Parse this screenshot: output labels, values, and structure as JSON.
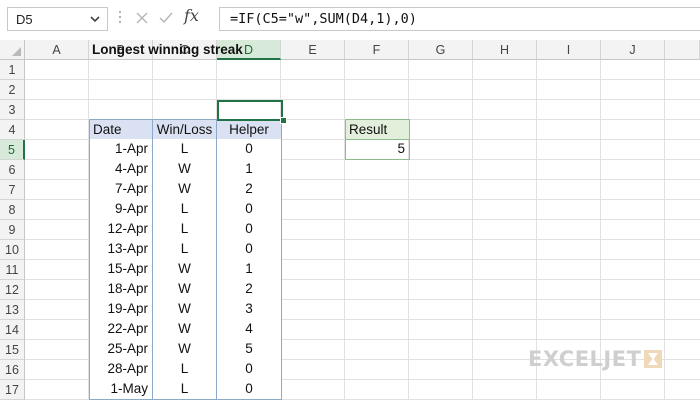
{
  "formula_bar": {
    "name_box": "D5",
    "fx_label": "fx",
    "formula": "=IF(C5=\"w\",SUM(D4,1),0)"
  },
  "column_headers": [
    "A",
    "B",
    "C",
    "D",
    "E",
    "F",
    "G",
    "H",
    "I",
    "J"
  ],
  "selected_column": "D",
  "row_numbers": [
    "1",
    "2",
    "3",
    "4",
    "5",
    "6",
    "7",
    "8",
    "9",
    "10",
    "11",
    "12",
    "13",
    "14",
    "15",
    "16",
    "17"
  ],
  "selected_row": "5",
  "sheet": {
    "title": "Longest winning streak",
    "table": {
      "headers": [
        "Date",
        "Win/Loss",
        "Helper"
      ],
      "rows": [
        [
          "1-Apr",
          "L",
          "0"
        ],
        [
          "4-Apr",
          "W",
          "1"
        ],
        [
          "7-Apr",
          "W",
          "2"
        ],
        [
          "9-Apr",
          "L",
          "0"
        ],
        [
          "12-Apr",
          "L",
          "0"
        ],
        [
          "13-Apr",
          "L",
          "0"
        ],
        [
          "15-Apr",
          "W",
          "1"
        ],
        [
          "18-Apr",
          "W",
          "2"
        ],
        [
          "19-Apr",
          "W",
          "3"
        ],
        [
          "22-Apr",
          "W",
          "4"
        ],
        [
          "25-Apr",
          "W",
          "5"
        ],
        [
          "28-Apr",
          "L",
          "0"
        ],
        [
          "1-May",
          "L",
          "0"
        ]
      ]
    },
    "result": {
      "label": "Result",
      "value": "5"
    }
  },
  "watermark": {
    "text": "EXCELJET"
  },
  "colors": {
    "table_header": "#d9e1f2",
    "table_border": "#8eaacb",
    "result_header": "#e2efda",
    "result_border": "#8dbb8f",
    "selection": "#217346"
  }
}
